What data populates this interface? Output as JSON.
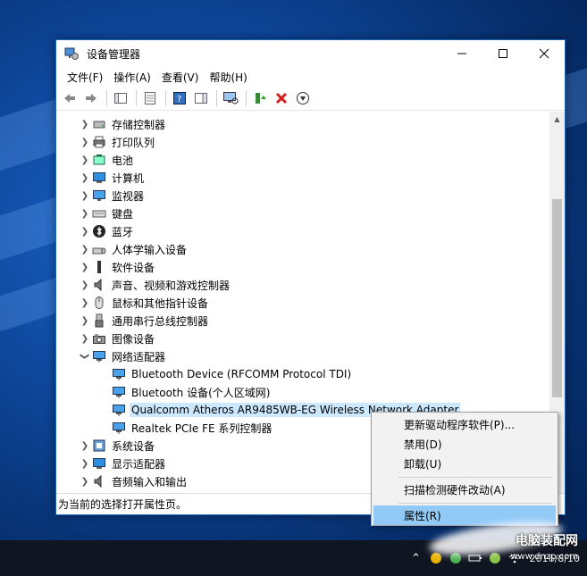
{
  "window": {
    "title": "设备管理器"
  },
  "menubar": [
    "文件(F)",
    "操作(A)",
    "查看(V)",
    "帮助(H)"
  ],
  "tree": {
    "categories": [
      {
        "label": "存储控制器",
        "icon": "storage-icon"
      },
      {
        "label": "打印队列",
        "icon": "printer-icon"
      },
      {
        "label": "电池",
        "icon": "battery-icon"
      },
      {
        "label": "计算机",
        "icon": "computer-icon"
      },
      {
        "label": "监视器",
        "icon": "monitor-icon"
      },
      {
        "label": "键盘",
        "icon": "keyboard-icon"
      },
      {
        "label": "蓝牙",
        "icon": "bluetooth-icon"
      },
      {
        "label": "人体学输入设备",
        "icon": "hid-icon"
      },
      {
        "label": "软件设备",
        "icon": "software-device-icon"
      },
      {
        "label": "声音、视频和游戏控制器",
        "icon": "speaker-icon"
      },
      {
        "label": "鼠标和其他指针设备",
        "icon": "mouse-icon"
      },
      {
        "label": "通用串行总线控制器",
        "icon": "usb-icon"
      },
      {
        "label": "图像设备",
        "icon": "camera-icon"
      },
      {
        "label": "网络适配器",
        "icon": "network-adapter-icon",
        "expanded": true
      }
    ],
    "network_children": [
      {
        "label": "Bluetooth Device (RFCOMM Protocol TDI)"
      },
      {
        "label": "Bluetooth 设备(个人区域网)"
      },
      {
        "label": "Qualcomm Atheros AR9485WB-EG Wireless Network Adapter",
        "selected": true
      },
      {
        "label": "Realtek PCIe FE 系列控制器"
      }
    ],
    "after": [
      {
        "label": "系统设备",
        "icon": "system-device-icon"
      },
      {
        "label": "显示适配器",
        "icon": "display-adapter-icon"
      },
      {
        "label": "音频输入和输出",
        "icon": "audio-io-icon"
      }
    ]
  },
  "status": {
    "text": "为当前的选择打开属性页。"
  },
  "context_menu": {
    "items": [
      "更新驱动程序软件(P)...",
      "禁用(D)",
      "卸载(U)",
      "扫描检测硬件改动(A)",
      "属性(R)"
    ]
  },
  "taskbar": {
    "date": "2016/8/10"
  },
  "watermark": {
    "line1": "电脑装配网",
    "line2": "www.dnzp.com"
  },
  "colors": {
    "selection": "#cce8ff",
    "menu_highlight": "#91c9f7",
    "accent": "#1a64b8"
  }
}
